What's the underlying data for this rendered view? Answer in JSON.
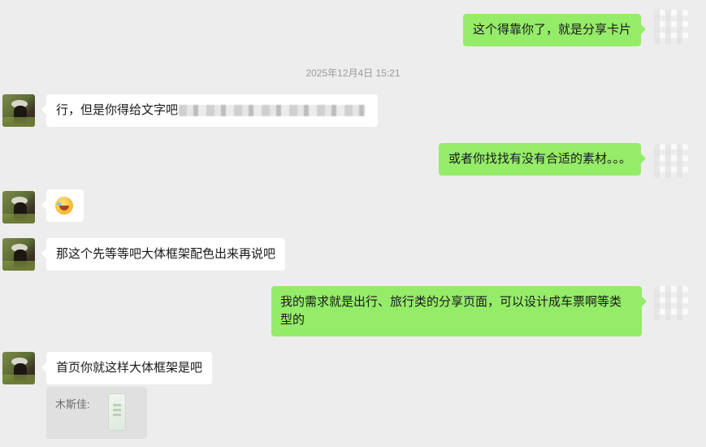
{
  "messages": {
    "m1": "这个得靠你了，就是分享卡片",
    "timestamp": "2025年12月4日 15:21",
    "m2": "行，但是你得给文字吧",
    "m3": "或者你找找有没有合适的素材。。。",
    "m4_emoji": "laughing-tears-emoji",
    "m5": "那这个先等等吧大体框架配色出来再说吧",
    "m6": "我的需求就是出行、旅行类的分享页面，可以设计成车票啊等类型的",
    "m7": "首页你就这样大体框架是吧",
    "quote_sender": "木斯佳:"
  },
  "colors": {
    "background": "#ededed",
    "bubble_self": "#95ec69",
    "bubble_other": "#ffffff",
    "timestamp_text": "#9a9a9a"
  }
}
